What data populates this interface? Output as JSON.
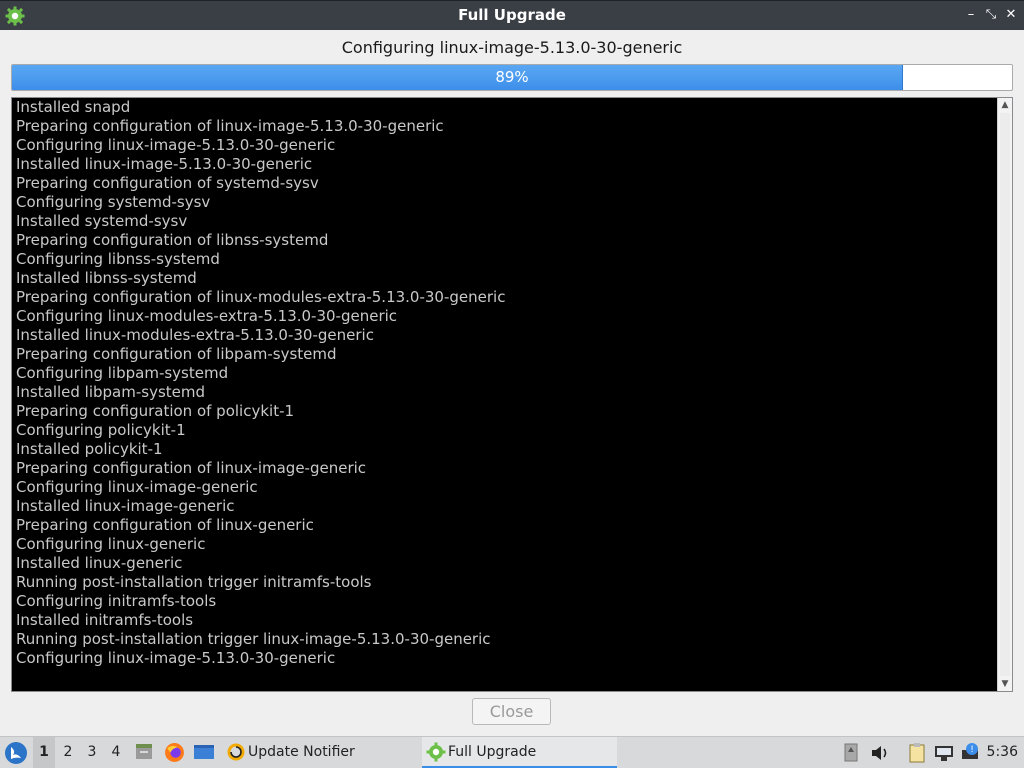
{
  "window": {
    "title": "Full Upgrade",
    "minimize_glyph": "–",
    "maximize_glyph": "⤡",
    "close_glyph": "✕"
  },
  "status": {
    "label": "Configuring linux-image-5.13.0-30-generic"
  },
  "progress": {
    "value": 0.89,
    "label": "89%",
    "fill_color": "#3d8eea"
  },
  "log": {
    "lines": [
      "Installed snapd",
      "Preparing configuration of linux-image-5.13.0-30-generic",
      "Configuring linux-image-5.13.0-30-generic",
      "Installed linux-image-5.13.0-30-generic",
      "Preparing configuration of systemd-sysv",
      "Configuring systemd-sysv",
      "Installed systemd-sysv",
      "Preparing configuration of libnss-systemd",
      "Configuring libnss-systemd",
      "Installed libnss-systemd",
      "Preparing configuration of linux-modules-extra-5.13.0-30-generic",
      "Configuring linux-modules-extra-5.13.0-30-generic",
      "Installed linux-modules-extra-5.13.0-30-generic",
      "Preparing configuration of libpam-systemd",
      "Configuring libpam-systemd",
      "Installed libpam-systemd",
      "Preparing configuration of policykit-1",
      "Configuring policykit-1",
      "Installed policykit-1",
      "Preparing configuration of linux-image-generic",
      "Configuring linux-image-generic",
      "Installed linux-image-generic",
      "Preparing configuration of linux-generic",
      "Configuring linux-generic",
      "Installed linux-generic",
      "Running post-installation trigger initramfs-tools",
      "Configuring initramfs-tools",
      "Installed initramfs-tools",
      "Running post-installation trigger linux-image-5.13.0-30-generic",
      "Configuring linux-image-5.13.0-30-generic"
    ]
  },
  "buttons": {
    "close_label": "Close"
  },
  "taskbar": {
    "desktops": [
      "1",
      "2",
      "3",
      "4"
    ],
    "active_desktop": "1",
    "tasks": [
      {
        "label": "Update Notifier",
        "icon": "update-notifier-icon"
      },
      {
        "label": "Full Upgrade",
        "icon": "gear-icon"
      }
    ],
    "clock": "5:36"
  }
}
